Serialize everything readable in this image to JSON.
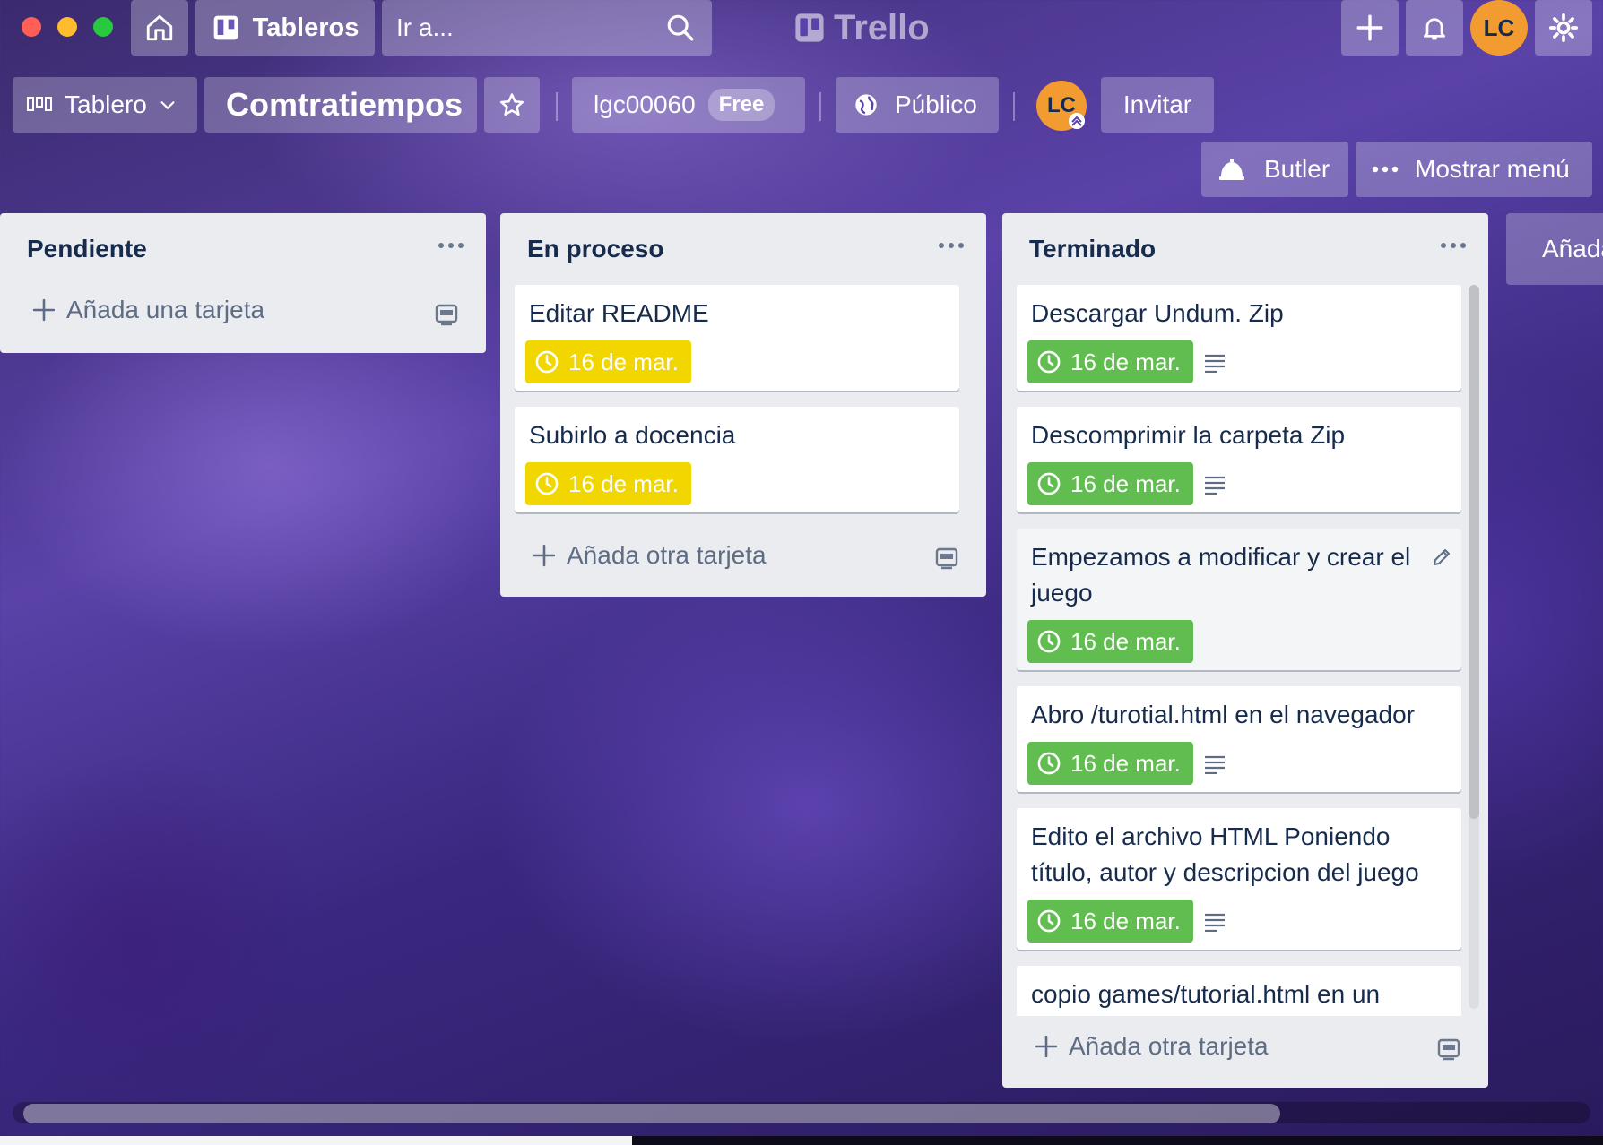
{
  "window": {
    "traffic_colors": [
      "#ff5f57",
      "#febc2e",
      "#28c840"
    ]
  },
  "topbar": {
    "boards_label": "Tableros",
    "search_placeholder": "Ir a...",
    "brand": "Trello",
    "user_initials": "LC"
  },
  "board_header": {
    "view_label": "Tablero",
    "board_name": "Comtratiempos",
    "team_name": "lgc00060",
    "team_plan": "Free",
    "visibility": "Público",
    "member_initials": "LC",
    "invite_label": "Invitar",
    "butler_label": "Butler",
    "menu_label": "Mostrar menú"
  },
  "lists": [
    {
      "title": "Pendiente",
      "cards": [],
      "add_label": "Añada una tarjeta"
    },
    {
      "title": "En proceso",
      "cards": [
        {
          "title": "Editar README",
          "due": "16 de mar.",
          "due_color": "#f2d600"
        },
        {
          "title": "Subirlo a docencia",
          "due": "16 de mar.",
          "due_color": "#f2d600"
        }
      ],
      "add_label": "Añada otra tarjeta"
    },
    {
      "title": "Terminado",
      "cards": [
        {
          "title": "Descargar Undum. Zip",
          "due": "16 de mar.",
          "due_color": "#61bd4f",
          "has_description": true
        },
        {
          "title": "Descomprimir la carpeta Zip",
          "due": "16 de mar.",
          "due_color": "#61bd4f",
          "has_description": true
        },
        {
          "title_line1": "Empezamos a modificar y crear el",
          "title_line2": "juego",
          "due": "16 de mar.",
          "due_color": "#61bd4f",
          "has_description": false
        },
        {
          "title": "Abro /turotial.html en el navegador",
          "due": "16 de mar.",
          "due_color": "#61bd4f",
          "has_description": true
        },
        {
          "title_line1": "Edito el archivo HTML Poniendo",
          "title_line2": "título, autor y descripcion del juego",
          "due": "16 de mar.",
          "due_color": "#61bd4f",
          "has_description": true
        },
        {
          "title": "copio games/tutorial.html en un"
        }
      ],
      "add_label": "Añada otra tarjeta"
    }
  ],
  "add_list_label": "Añada otra lista"
}
